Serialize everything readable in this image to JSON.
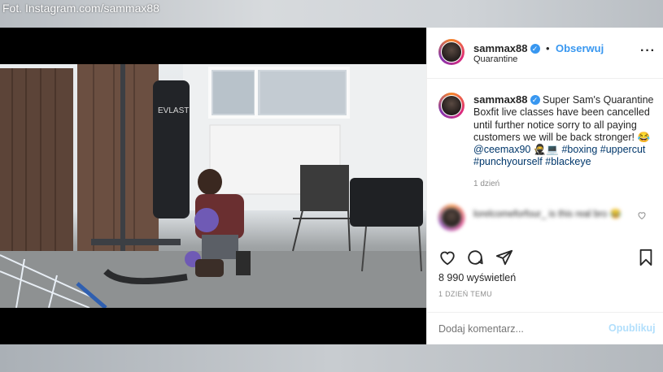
{
  "credit": "Fot. Instagram.com/sammax88",
  "header": {
    "username": "sammax88",
    "separator": "•",
    "follow_label": "Obserwuj",
    "location": "Quarantine",
    "more_icon": "more-horizontal-icon"
  },
  "caption": {
    "username": "sammax88",
    "text_part1": "Super Sam's Quarantine Boxfit live classes have been cancelled until further notice sorry to all paying customers we will be back stronger!",
    "emoji1": "😂",
    "mention": "@ceemax90",
    "emoji2": "🥷💻",
    "hashtags": [
      "#boxing",
      "#uppercut",
      "#punchyourself",
      "#blackeye"
    ],
    "time": "1 dzień"
  },
  "blurred_comment": {
    "text": "lorelcomeforfour_ is this real bro 😂",
    "emoji": "😂"
  },
  "actions": {
    "like_icon": "heart-icon",
    "comment_icon": "comment-icon",
    "share_icon": "share-icon",
    "save_icon": "bookmark-icon"
  },
  "stats": {
    "views": "8 990 wyświetleń",
    "posted": "1 DZIEŃ TEMU"
  },
  "comment_input": {
    "placeholder": "Dodaj komentarz...",
    "post_label": "Opublikuj"
  },
  "colors": {
    "accent": "#3897f0",
    "text": "#262626",
    "muted": "#8e8e8e",
    "hashtag": "#00376b"
  }
}
